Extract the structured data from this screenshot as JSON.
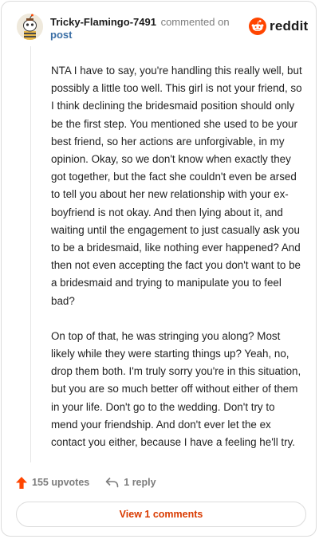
{
  "comment": {
    "author": "Tricky-Flamingo-7491",
    "commented_on": "commented on",
    "post_link": "post",
    "brand": "reddit",
    "paragraphs": [
      "NTA I have to say, you're handling this really well, but possibly a little too well. This girl is not your friend, so I think declining the bridesmaid position should only be the first step. You mentioned she used to be your best friend, so her actions are unforgivable, in my opinion. Okay, so we don't know when exactly they got together, but the fact she couldn't even be arsed to tell you about her new relationship with your ex-boyfriend is not okay. And then lying about it, and waiting until the engagement to just casually ask you to be a bridesmaid, like nothing ever happened? And then not even accepting the fact you don't want to be a bridesmaid and trying to manipulate you to feel bad?",
      "On top of that, he was stringing you along? Most likely while they were starting things up? Yeah, no, drop them both. I'm truly sorry you're in this situation, but you are so much better off without either of them in your life. Don't go to the wedding. Don't try to mend your friendship. And don't ever let the ex contact you either, because I have a feeling he'll try."
    ],
    "upvotes": "155 upvotes",
    "replies": "1 reply",
    "view_comments": "View 1 comments"
  },
  "colors": {
    "brand_orange": "#ff4500",
    "link_blue": "#3a6ea5",
    "view_button_text": "#d93a00"
  },
  "icons": {
    "avatar": "avatar-snoo",
    "logo": "reddit-snoo-icon",
    "upvote": "upvote-arrow-icon",
    "reply": "reply-arrow-icon"
  }
}
